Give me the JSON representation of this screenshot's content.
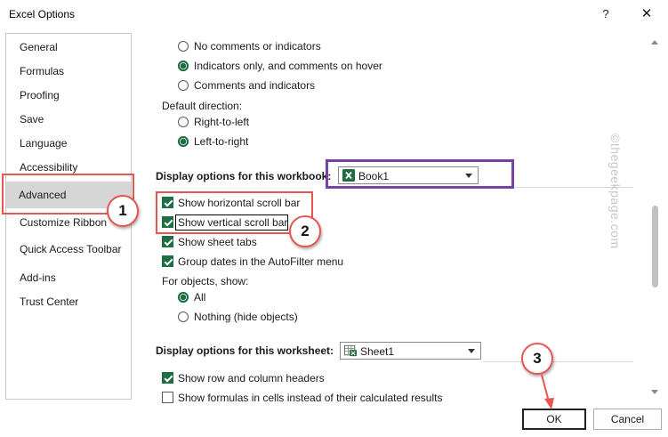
{
  "window": {
    "title": "Excel Options",
    "help": "?",
    "close": "✕"
  },
  "sidebar": {
    "items": [
      {
        "label": "General"
      },
      {
        "label": "Formulas"
      },
      {
        "label": "Proofing"
      },
      {
        "label": "Save"
      },
      {
        "label": "Language"
      },
      {
        "label": "Accessibility"
      },
      {
        "label": "Advanced"
      },
      {
        "label": "Customize Ribbon"
      },
      {
        "label": "Quick Access Toolbar"
      },
      {
        "label": "Add-ins"
      },
      {
        "label": "Trust Center"
      }
    ],
    "selected": "Advanced"
  },
  "comments": {
    "option_none": "No comments or indicators",
    "option_indicators": "Indicators only, and comments on hover",
    "option_both": "Comments and indicators",
    "selected": "option_indicators"
  },
  "direction": {
    "label": "Default direction:",
    "rtl": "Right-to-left",
    "ltr": "Left-to-right",
    "selected": "ltr"
  },
  "workbook": {
    "heading": "Display options for this workbook:",
    "selected": "Book1",
    "show_hscroll": "Show horizontal scroll bar",
    "show_vscroll": "Show vertical scroll bar",
    "show_tabs": "Show sheet tabs",
    "group_dates": "Group dates in the AutoFilter menu",
    "objects_label": "For objects, show:",
    "objects_all": "All",
    "objects_nothing": "Nothing (hide objects)",
    "objects_selected": "All"
  },
  "worksheet": {
    "heading": "Display options for this worksheet:",
    "selected": "Sheet1",
    "show_headers": "Show row and column headers",
    "show_formulas": "Show formulas in cells instead of their calculated results"
  },
  "buttons": {
    "ok": "OK",
    "cancel": "Cancel"
  },
  "annotations": {
    "step1": "1",
    "step2": "2",
    "step3": "3",
    "watermark": "©thegeekpage.com"
  },
  "colors": {
    "accent_green": "#1f6e43",
    "highlight_red": "#e8564f",
    "highlight_purple": "#7b3fa6"
  }
}
